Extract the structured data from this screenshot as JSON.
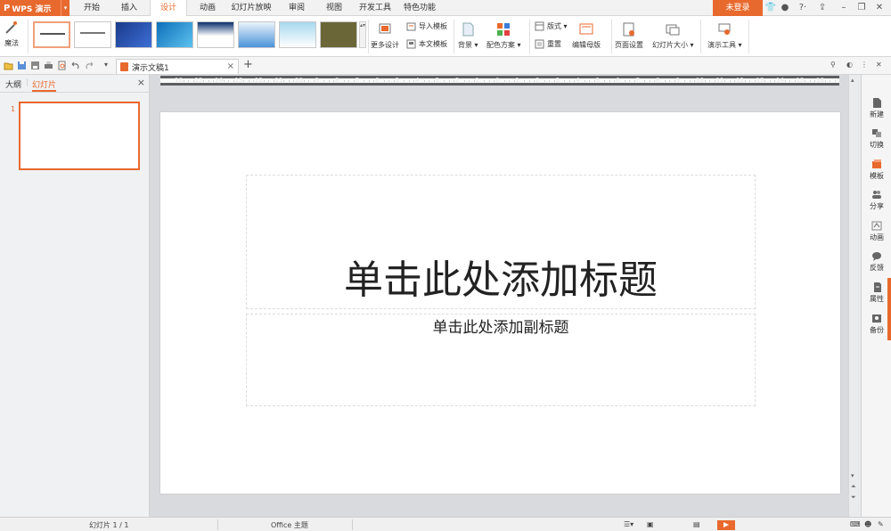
{
  "app": {
    "name": "WPS 演示",
    "login_label": "未登录"
  },
  "menu_tabs": [
    "开始",
    "插入",
    "设计",
    "动画",
    "幻灯片放映",
    "审阅",
    "视图",
    "开发工具",
    "特色功能"
  ],
  "active_menu_tab": "设计",
  "ribbon": {
    "magic_label": "魔法",
    "more_design_label": "更多设计",
    "import_template_label": "导入模板",
    "this_template_label": "本文模板",
    "background_label": "背景",
    "color_scheme_label": "配色方案",
    "layout_label": "版式",
    "reset_label": "重置",
    "edit_master_label": "编辑母版",
    "page_setup_label": "页面设置",
    "slide_size_label": "幻灯片大小",
    "present_tools_label": "演示工具"
  },
  "document": {
    "tab_title": "演示文稿1",
    "close_glyph": "×",
    "add_glyph": "+"
  },
  "left_panel": {
    "outline_tab": "大纲",
    "slides_tab": "幻灯片",
    "close_glyph": "×",
    "slide_numbers": [
      "1"
    ]
  },
  "slide": {
    "title_placeholder": "单击此处添加标题",
    "subtitle_placeholder": "单击此处添加副标题"
  },
  "ruler": {
    "labels": [
      "16",
      "15",
      "14",
      "13",
      "12",
      "11",
      "10",
      "9",
      "8",
      "7",
      "6",
      "5",
      "4",
      "3",
      "2",
      "1",
      "0",
      "1",
      "2",
      "3",
      "4",
      "5",
      "6",
      "7",
      "8",
      "9",
      "10",
      "11",
      "12",
      "13",
      "14",
      "15",
      "16"
    ]
  },
  "right_sidebar": [
    "新建",
    "切换",
    "模板",
    "分享",
    "动画",
    "反馈",
    "属性",
    "备份"
  ],
  "status": {
    "slide_count": "幻灯片 1 / 1",
    "theme": "Office 主题"
  },
  "colors": {
    "accent": "#e8692d"
  }
}
